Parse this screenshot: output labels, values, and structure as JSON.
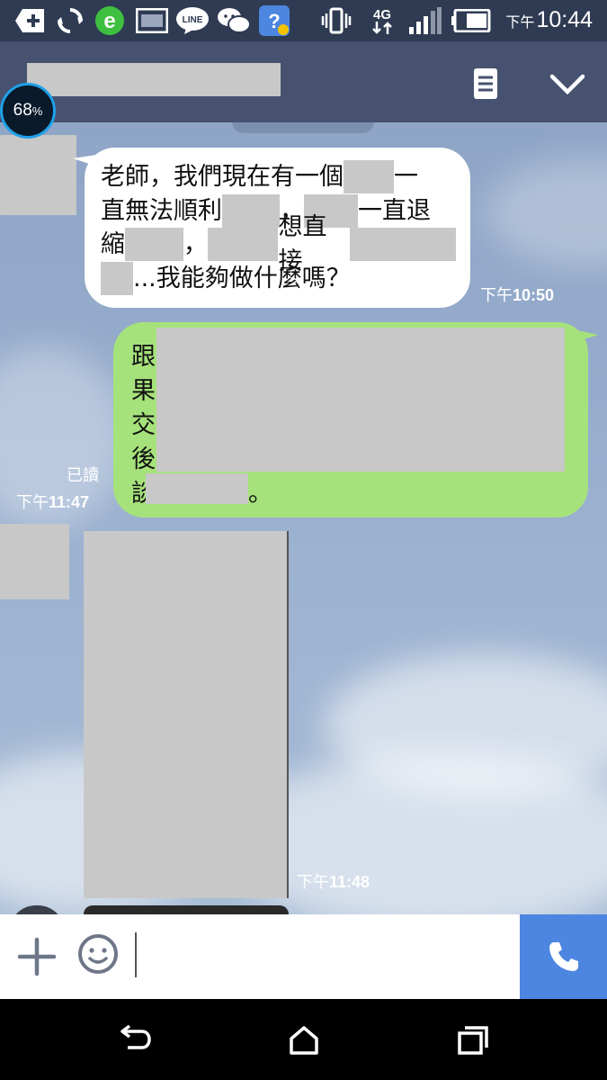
{
  "status_bar": {
    "time_prefix": "下午",
    "time": "10:44",
    "network": "4G",
    "icons": [
      "add-box-icon",
      "sync-icon",
      "browser-e-icon",
      "gallery-icon",
      "line-app-icon",
      "wechat-icon",
      "help-bot-icon",
      "vibrate-icon",
      "network-4g-icon",
      "signal-icon",
      "battery-icon"
    ]
  },
  "header": {
    "title_redacted": true,
    "notes_icon": "notes-icon",
    "collapse_icon": "chevron-down-icon"
  },
  "battery_widget": {
    "value": "68",
    "unit": "%"
  },
  "messages": [
    {
      "direction": "incoming",
      "segments": {
        "line1_a": "老師，我們現在有一個",
        "line1_b": "一",
        "line2_a": "直無法順利",
        "line2_b": "，",
        "line2_c": "一直退",
        "line3_a": "縮",
        "line3_b": "，",
        "line3_c": "想直接",
        "line4_b": "...我能夠做什麼嗎？"
      },
      "time_prefix": "下午",
      "time": "10:50"
    },
    {
      "direction": "outgoing",
      "chars": [
        "跟",
        "果",
        "交",
        "後",
        "談"
      ],
      "tail": "。",
      "read_label": "已讀",
      "time_prefix": "下午",
      "time": "11:47"
    },
    {
      "direction": "incoming",
      "type": "image",
      "time_prefix": "下午",
      "time": "11:48"
    }
  ],
  "input_bar": {
    "add_icon": "plus-icon",
    "emoji_icon": "emoji-icon",
    "placeholder": "",
    "call_icon": "phone-icon"
  },
  "nav_bar": {
    "icons": [
      "back-icon",
      "home-icon",
      "recent-apps-icon"
    ]
  },
  "colors": {
    "status_bar": "#2f3b52",
    "header": "#475270",
    "incoming_bubble": "#ffffff",
    "outgoing_bubble": "#a6e27c",
    "call_button": "#4d86e0"
  }
}
